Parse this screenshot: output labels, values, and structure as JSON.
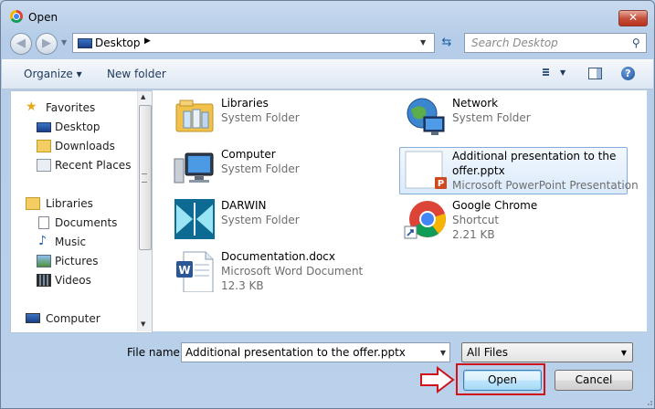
{
  "window": {
    "title": "Open",
    "close_glyph": "✕"
  },
  "nav": {
    "back_glyph": "◀",
    "forward_glyph": "▶",
    "address_text": "Desktop",
    "address_arrow": "▶",
    "search_placeholder": "Search Desktop"
  },
  "toolbar": {
    "organize_label": "Organize ▾",
    "new_folder_label": "New folder",
    "help_glyph": "?"
  },
  "sidebar": {
    "favorites": {
      "label": "Favorites",
      "items": [
        "Desktop",
        "Downloads",
        "Recent Places"
      ]
    },
    "libraries": {
      "label": "Libraries",
      "items": [
        "Documents",
        "Music",
        "Pictures",
        "Videos"
      ]
    },
    "computer": {
      "label": "Computer"
    }
  },
  "files": [
    {
      "name": "Libraries",
      "sub1": "System Folder",
      "sub2": "",
      "icon": "libraries-folder-icon"
    },
    {
      "name": "Network",
      "sub1": "System Folder",
      "sub2": "",
      "icon": "network-globe-icon"
    },
    {
      "name": "Computer",
      "sub1": "System Folder",
      "sub2": "",
      "icon": "computer-monitor-icon"
    },
    {
      "name": "Additional presentation to the offer.pptx",
      "sub1": "Microsoft PowerPoint Presentation",
      "sub2": "",
      "icon": "powerpoint-file-icon",
      "selected": true
    },
    {
      "name": "DARWIN",
      "sub1": "System Folder",
      "sub2": "",
      "icon": "darwin-app-icon"
    },
    {
      "name": "Google Chrome",
      "sub1": "Shortcut",
      "sub2": "2.21 KB",
      "icon": "chrome-shortcut-icon"
    },
    {
      "name": "Documentation.docx",
      "sub1": "Microsoft Word Document",
      "sub2": "12.3 KB",
      "icon": "word-file-icon"
    }
  ],
  "footer": {
    "file_name_label": "File name:",
    "file_name_value": "Additional presentation to the offer.pptx",
    "file_type_value": "All Files",
    "open_label": "Open",
    "cancel_label": "Cancel"
  },
  "colors": {
    "accent": "#3c7fb1",
    "highlight": "#d0121b",
    "selection": "#dbeafc"
  }
}
